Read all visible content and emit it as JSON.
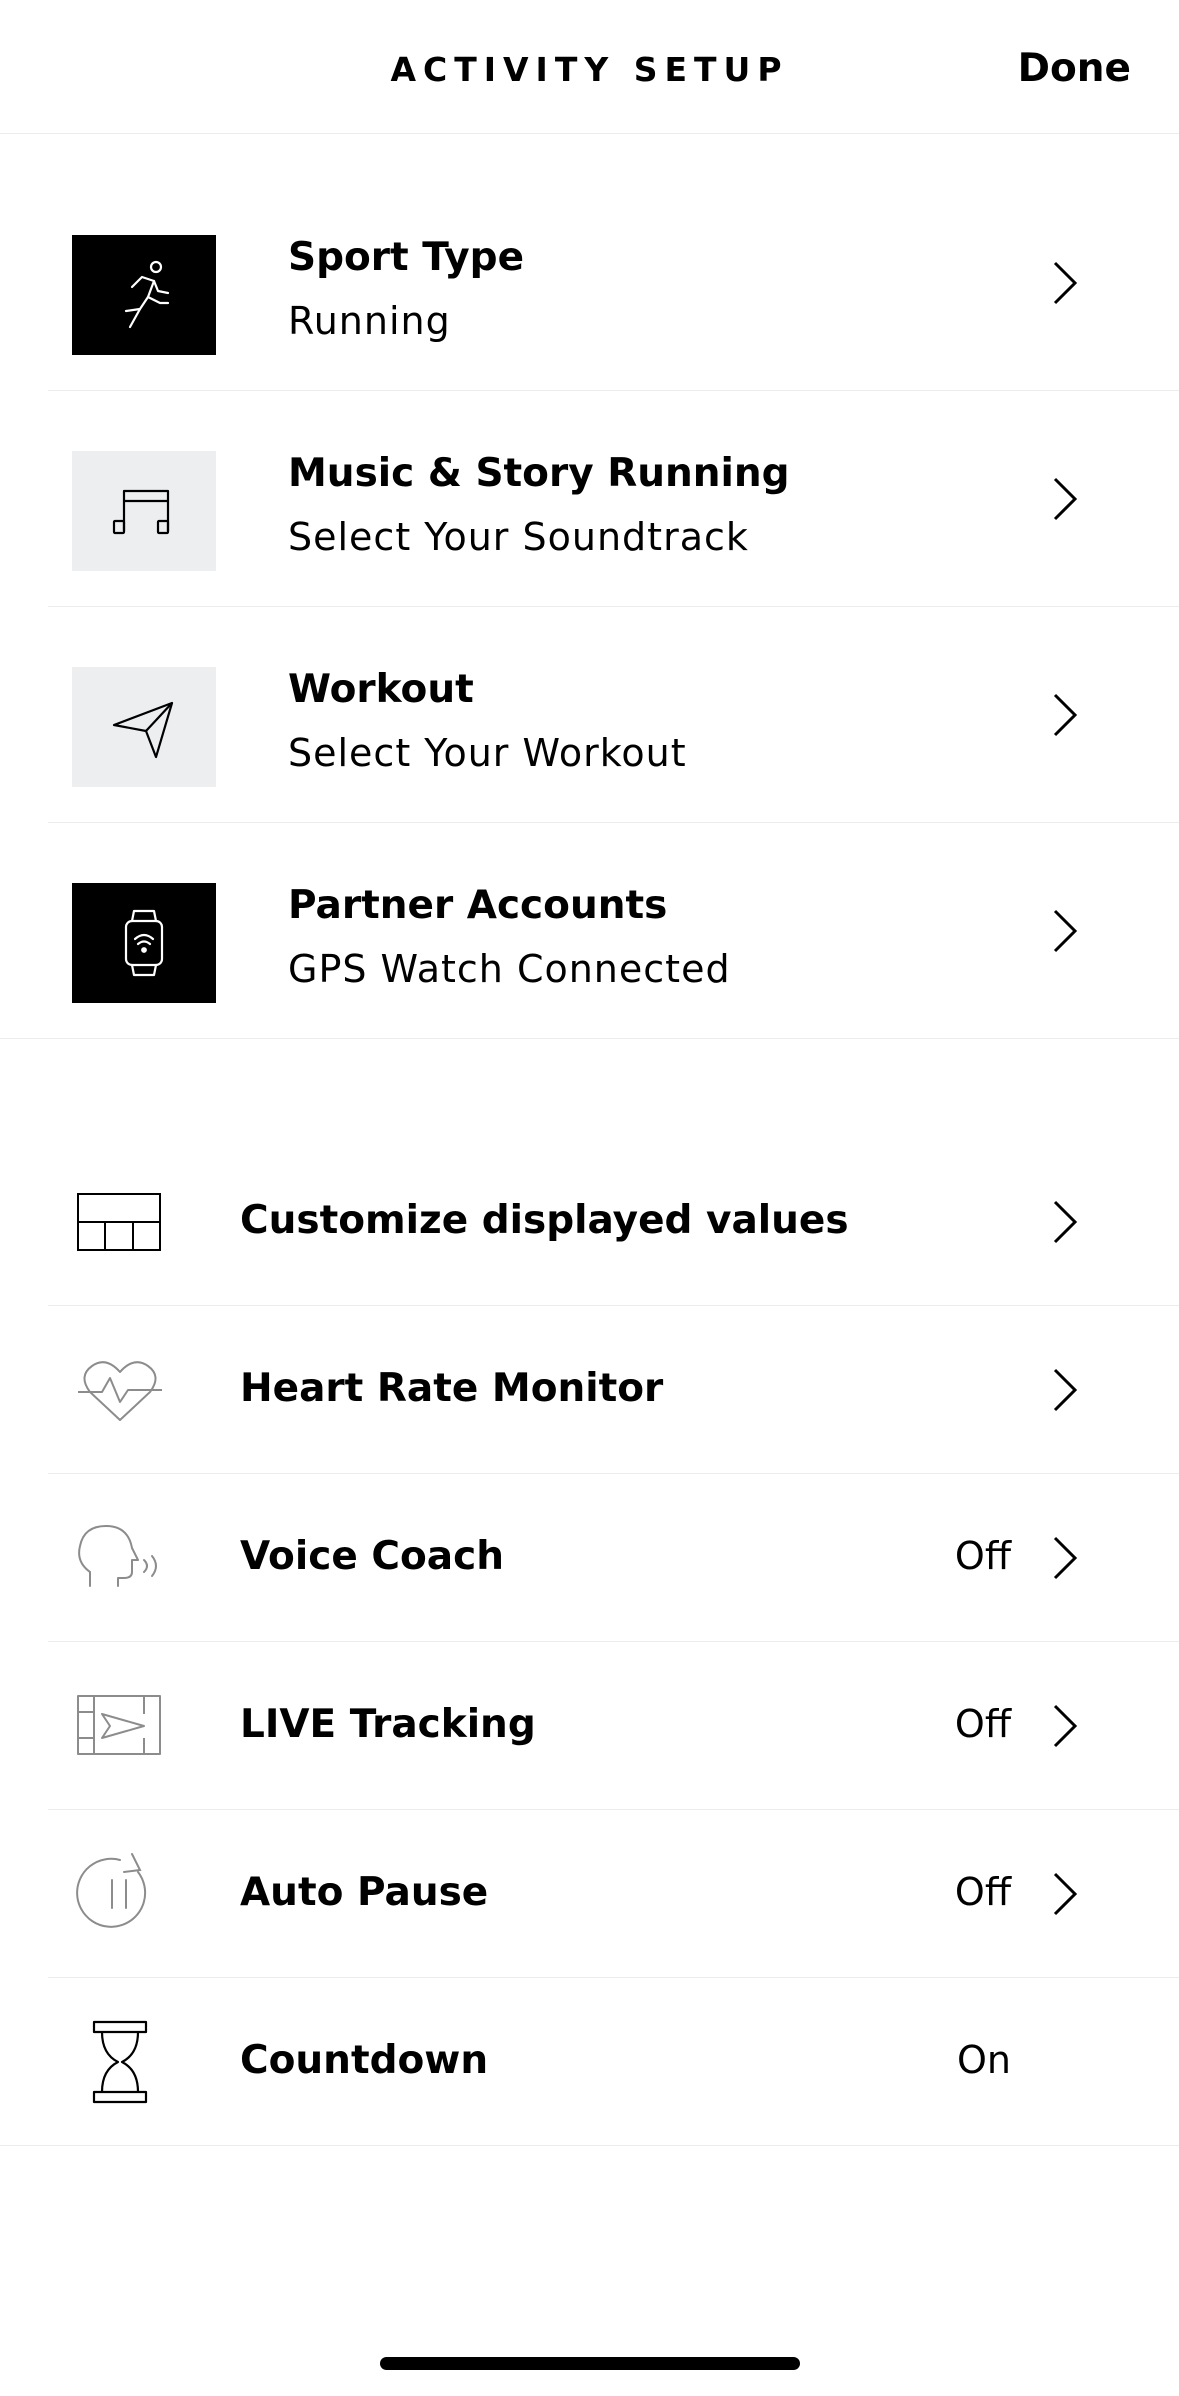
{
  "header": {
    "title": "ACTIVITY SETUP",
    "done_label": "Done"
  },
  "cards": [
    {
      "title": "Sport Type",
      "subtitle": "Running",
      "icon": "running-person-icon",
      "tile": "dark"
    },
    {
      "title": "Music & Story Running",
      "subtitle": "Select Your Soundtrack",
      "icon": "music-note-icon",
      "tile": "light"
    },
    {
      "title": "Workout",
      "subtitle": "Select Your Workout",
      "icon": "navigation-arrow-icon",
      "tile": "light"
    },
    {
      "title": "Partner Accounts",
      "subtitle": "GPS Watch Connected",
      "icon": "smartwatch-icon",
      "tile": "dark"
    }
  ],
  "settings": [
    {
      "label": "Customize displayed values",
      "value": "",
      "icon": "grid-layout-icon"
    },
    {
      "label": "Heart Rate Monitor",
      "value": "",
      "icon": "heart-rate-icon"
    },
    {
      "label": "Voice Coach",
      "value": "Off",
      "icon": "voice-head-icon"
    },
    {
      "label": "LIVE Tracking",
      "value": "Off",
      "icon": "live-tracking-map-icon"
    },
    {
      "label": "Auto Pause",
      "value": "Off",
      "icon": "auto-pause-icon"
    },
    {
      "label": "Countdown",
      "value": "On",
      "icon": "hourglass-icon"
    }
  ]
}
